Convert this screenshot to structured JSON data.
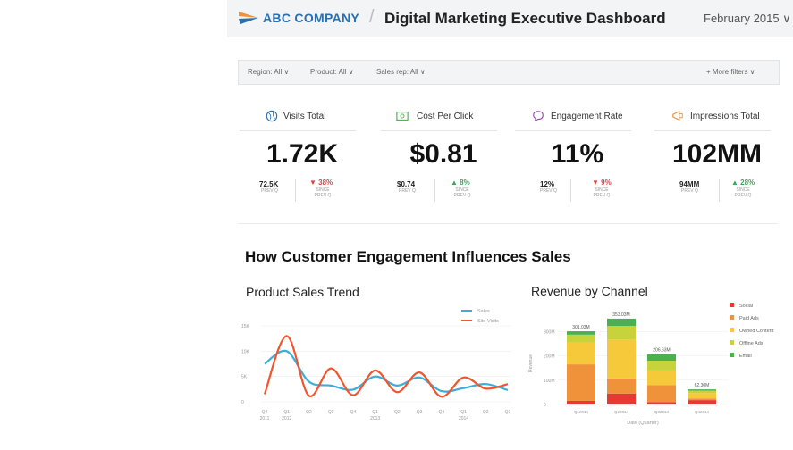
{
  "header": {
    "company": "ABC COMPANY",
    "separator": "/",
    "title": "Digital Marketing Executive Dashboard",
    "period": "February 2015 ∨"
  },
  "filters": {
    "region": "Region: All ∨",
    "product": "Product: All ∨",
    "sales_rep": "Sales rep: All ∨",
    "more": "+ More filters ∨"
  },
  "kpis": [
    {
      "label": "Visits Total",
      "icon": "globe-icon",
      "value": "1.72K",
      "prev_value": "72.5K",
      "prev_caption": "PREV Q",
      "delta": "▼ 38%",
      "delta_caption": "SINCE PREV Q",
      "direction": "down"
    },
    {
      "label": "Cost Per Click",
      "icon": "money-icon",
      "value": "$0.81",
      "prev_value": "$0.74",
      "prev_caption": "PREV Q",
      "delta": "▲ 8%",
      "delta_caption": "SINCE PREV Q",
      "direction": "up"
    },
    {
      "label": "Engagement Rate",
      "icon": "chat-bubble-icon",
      "value": "11%",
      "prev_value": "12%",
      "prev_caption": "PREV Q",
      "delta": "▼ 9%",
      "delta_caption": "SINCE PREV Q",
      "direction": "down"
    },
    {
      "label": "Impressions Total",
      "icon": "megaphone-icon",
      "value": "102MM",
      "prev_value": "94MM",
      "prev_caption": "PREV Q",
      "delta": "▲ 28%",
      "delta_caption": "SINCE PREV Q",
      "direction": "up"
    }
  ],
  "colors": {
    "up": "#3aa657",
    "down": "#e0403f",
    "brand": "#2a6fb0",
    "sales": "#3aaed8",
    "site_visits": "#f0552e"
  },
  "section_title": "How Customer Engagement Influences Sales",
  "chart_data": [
    {
      "type": "line",
      "title": "Product Sales Trend",
      "y_ticks": [
        "15K",
        "10K",
        "5K",
        "0"
      ],
      "ylim": [
        0,
        15000
      ],
      "x_labels": [
        "Q4\n2011",
        "Q1\n2012",
        "Q2",
        "Q3",
        "Q4",
        "Q1\n2013",
        "Q2",
        "Q3",
        "Q4",
        "Q1\n2014",
        "Q2",
        "Q3"
      ],
      "x": [
        0,
        1,
        2,
        3,
        4,
        5,
        6,
        7,
        8,
        9,
        10,
        11
      ],
      "series": [
        {
          "name": "Sales",
          "color": "#3aaed8",
          "values": [
            7500,
            10000,
            4000,
            3200,
            2400,
            5000,
            3200,
            4800,
            2100,
            2700,
            3500,
            2300
          ]
        },
        {
          "name": "Site Visits",
          "color": "#f0552e",
          "values": [
            1500,
            13000,
            1200,
            6600,
            1300,
            6200,
            1900,
            5800,
            1000,
            4800,
            2600,
            3500
          ]
        }
      ]
    },
    {
      "type": "bar",
      "stacked": true,
      "title": "Revenue by Channel",
      "ylabel": "Revenue",
      "xlabel": "Date (Quarter)",
      "y_ticks": [
        "300M",
        "200M",
        "100M",
        "0"
      ],
      "ylim": [
        0,
        360
      ],
      "categories": [
        "Q1 2014",
        "Q2 2014",
        "Q3 2014",
        "Q4 2014"
      ],
      "totals": [
        "301.03M",
        "353.03M",
        "206.63M",
        "62.30M"
      ],
      "series": [
        {
          "name": "Social",
          "color": "#e53935",
          "values": [
            15,
            45,
            10,
            18
          ]
        },
        {
          "name": "Paid Ads",
          "color": "#f0923a",
          "values": [
            150,
            62,
            70,
            7
          ]
        },
        {
          "name": "Owned Content",
          "color": "#f6c93b",
          "values": [
            90,
            160,
            60,
            22
          ]
        },
        {
          "name": "Offline Ads",
          "color": "#c6d33b",
          "values": [
            32,
            56,
            40,
            10
          ]
        },
        {
          "name": "Email",
          "color": "#4caf50",
          "values": [
            14,
            30,
            27,
            5
          ]
        }
      ]
    }
  ]
}
